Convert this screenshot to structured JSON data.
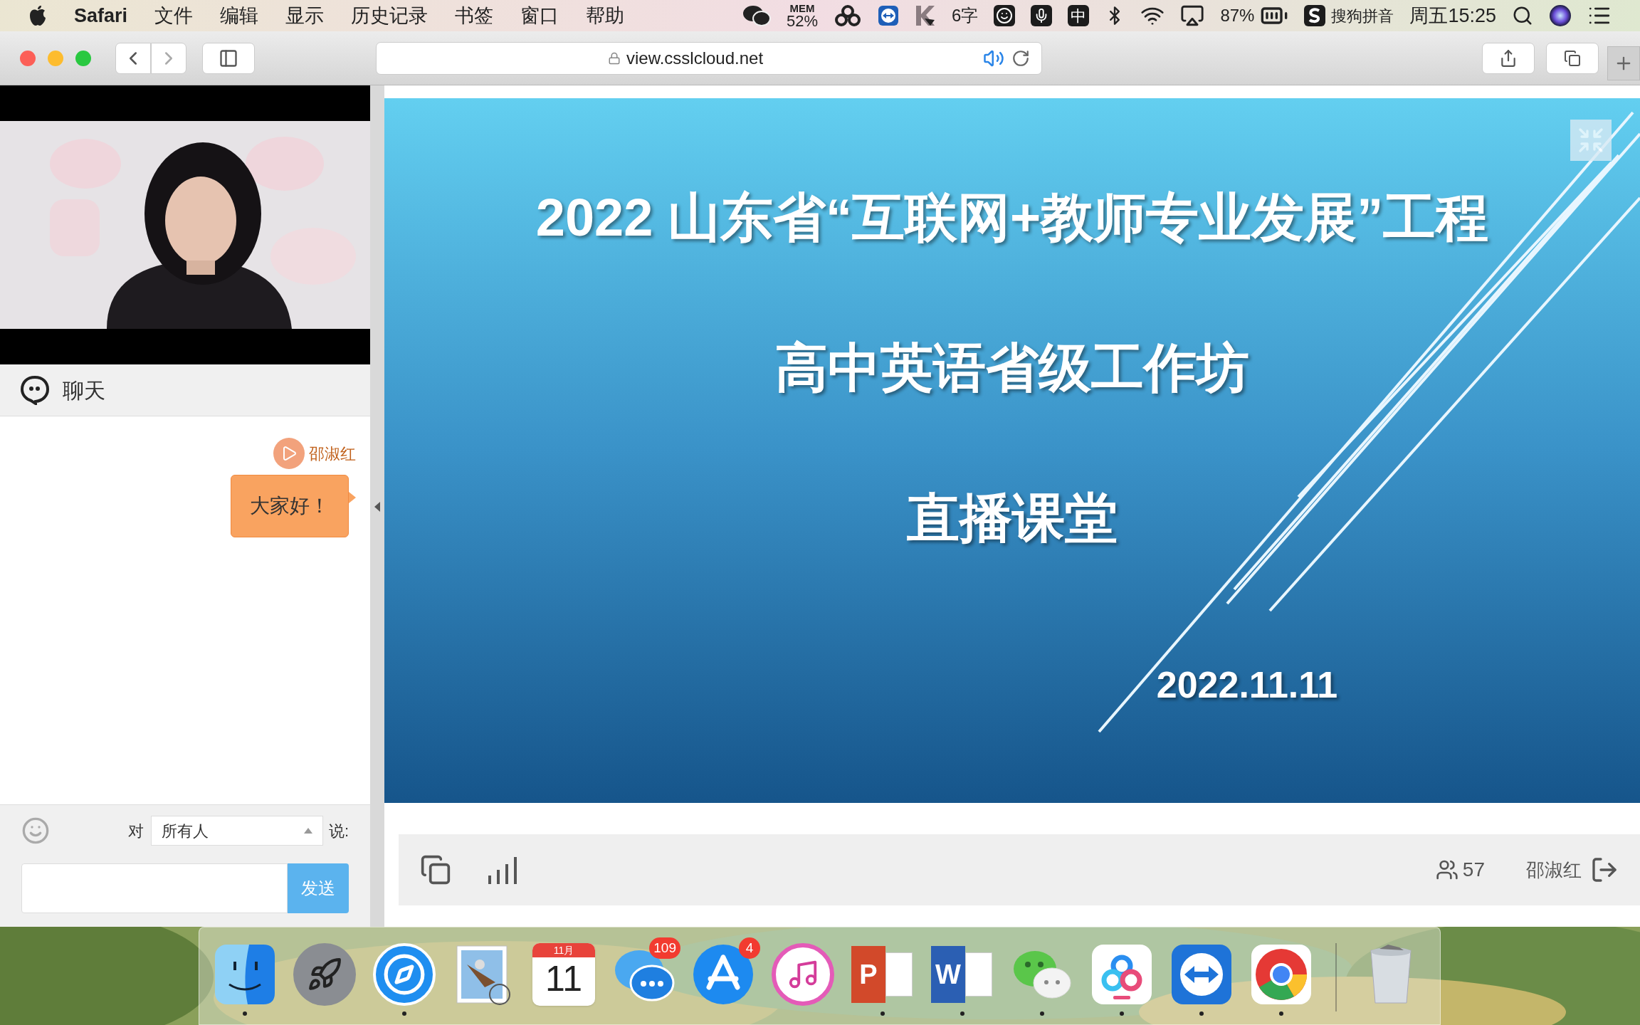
{
  "menu_bar": {
    "app_name": "Safari",
    "menus": [
      "文件",
      "编辑",
      "显示",
      "历史记录",
      "书签",
      "窗口",
      "帮助"
    ],
    "status_items": [
      {
        "kind": "wechat"
      },
      {
        "kind": "mem",
        "label": "MEM",
        "text": "52%"
      },
      {
        "kind": "cloud"
      },
      {
        "kind": "teamviewer"
      },
      {
        "kind": "k"
      },
      {
        "kind": "text",
        "text": "6字"
      },
      {
        "kind": "smiley"
      },
      {
        "kind": "mic"
      },
      {
        "kind": "boxed",
        "text": "中"
      },
      {
        "kind": "bluetooth"
      },
      {
        "kind": "wifi"
      },
      {
        "kind": "airplay"
      },
      {
        "kind": "battery",
        "text": "87%"
      },
      {
        "kind": "sogou",
        "text": "搜狗拼音"
      },
      {
        "kind": "clock",
        "text": "周五15:25"
      },
      {
        "kind": "search"
      },
      {
        "kind": "siri"
      },
      {
        "kind": "list"
      }
    ]
  },
  "browser": {
    "address": "view.csslcloud.net"
  },
  "chat": {
    "title": "聊天",
    "messages": [
      {
        "sender": "邵淑红",
        "text": "大家好！"
      }
    ],
    "recipient_label": "对",
    "recipient": "所有人",
    "say_label": "说:",
    "send_button": "发送"
  },
  "slide": {
    "title": "2022 山东省“互联网+教师专业发展”工程",
    "subtitle": "高中英语省级工作坊",
    "heading": "直播课堂",
    "date": "2022.11.11"
  },
  "bottom_bar": {
    "viewer_count": "57",
    "user_name": "邵淑红"
  },
  "dock": [
    {
      "kind": "finder",
      "running": true
    },
    {
      "kind": "launchpad",
      "running": false
    },
    {
      "kind": "safari",
      "running": true
    },
    {
      "kind": "mail",
      "running": false
    },
    {
      "kind": "calendar",
      "month": "11月",
      "day": "11",
      "running": false
    },
    {
      "kind": "messages",
      "badge": "109",
      "running": false
    },
    {
      "kind": "appstore",
      "badge": "4",
      "running": false
    },
    {
      "kind": "music",
      "running": false
    },
    {
      "kind": "powerpoint",
      "letter": "P",
      "running": true
    },
    {
      "kind": "word",
      "letter": "W",
      "running": true
    },
    {
      "kind": "wechat",
      "running": true
    },
    {
      "kind": "baidu",
      "running": true
    },
    {
      "kind": "teamviewer",
      "running": true
    },
    {
      "kind": "chrome",
      "running": true
    },
    {
      "kind": "separator"
    },
    {
      "kind": "trash",
      "running": false
    }
  ]
}
